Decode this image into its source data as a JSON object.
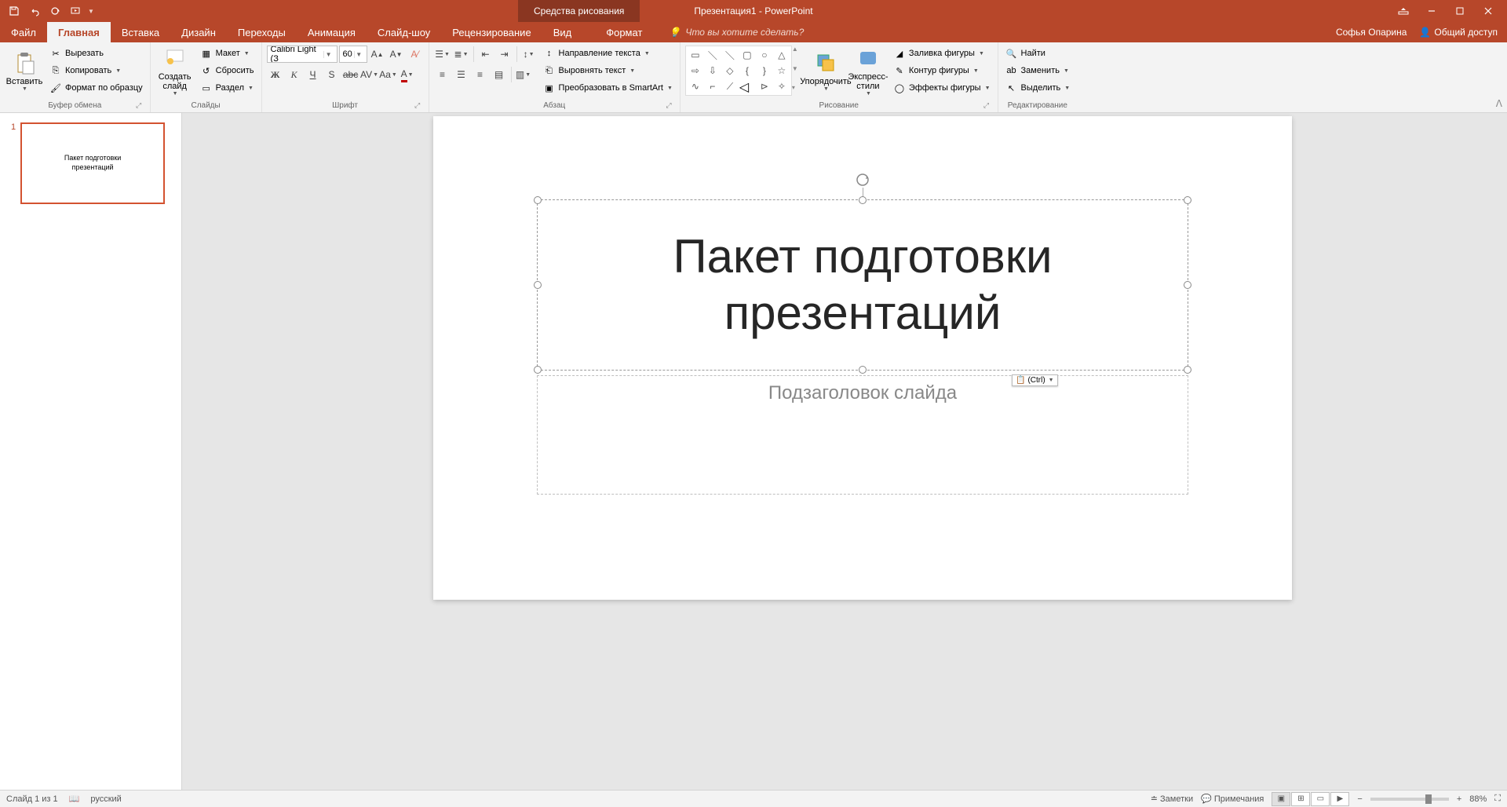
{
  "titlebar": {
    "doc_title": "Презентация1 - PowerPoint",
    "contextual": "Средства рисования"
  },
  "tabs": {
    "file": "Файл",
    "home": "Главная",
    "insert": "Вставка",
    "design": "Дизайн",
    "transitions": "Переходы",
    "animations": "Анимация",
    "slideshow": "Слайд-шоу",
    "review": "Рецензирование",
    "view": "Вид",
    "format": "Формат",
    "tellme": "Что вы хотите сделать?",
    "user": "Софья Опарина",
    "share": "Общий доступ"
  },
  "ribbon": {
    "clipboard": {
      "paste": "Вставить",
      "cut": "Вырезать",
      "copy": "Копировать",
      "format_painter": "Формат по образцу",
      "label": "Буфер обмена"
    },
    "slides": {
      "new_slide": "Создать слайд",
      "layout": "Макет",
      "reset": "Сбросить",
      "section": "Раздел",
      "label": "Слайды"
    },
    "font": {
      "name": "Calibri Light (З",
      "size": "60",
      "bold": "Ж",
      "italic": "К",
      "underline": "Ч",
      "shadow": "S",
      "strike": "abc",
      "spacing": "AV",
      "case": "Aa",
      "label": "Шрифт"
    },
    "paragraph": {
      "text_direction": "Направление текста",
      "align_text": "Выровнять текст",
      "smartart": "Преобразовать в SmartArt",
      "label": "Абзац"
    },
    "drawing": {
      "arrange": "Упорядочить",
      "quick_styles": "Экспресс-стили",
      "shape_fill": "Заливка фигуры",
      "shape_outline": "Контур фигуры",
      "shape_effects": "Эффекты фигуры",
      "label": "Рисование"
    },
    "editing": {
      "find": "Найти",
      "replace": "Заменить",
      "select": "Выделить",
      "label": "Редактирование"
    }
  },
  "thumb": {
    "number": "1",
    "line1": "Пакет подготовки",
    "line2": "презентаций"
  },
  "slide": {
    "title": "Пакет подготовки презентаций",
    "subtitle": "Подзаголовок слайда",
    "paste_ctrl": "(Ctrl)"
  },
  "statusbar": {
    "slide_of": "Слайд 1 из 1",
    "language": "русский",
    "notes": "Заметки",
    "comments": "Примечания",
    "zoom": "88%"
  }
}
